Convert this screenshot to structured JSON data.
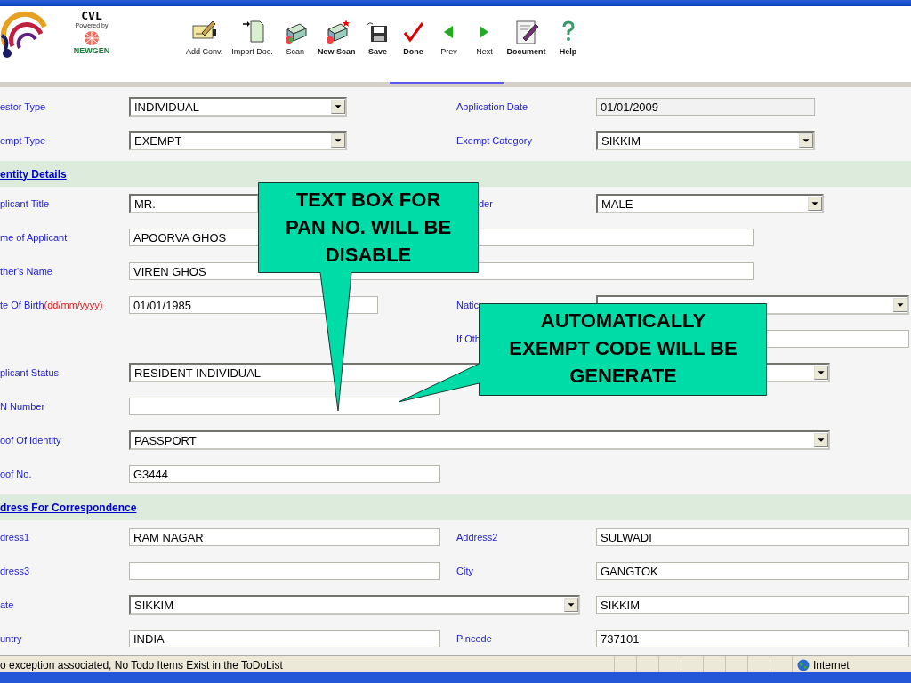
{
  "toolbar": {
    "logo": {
      "title": "CVL",
      "powered_by": "Powered by",
      "vendor": "NEWGEN"
    },
    "buttons": [
      {
        "label": "Add Conv.",
        "bold": false
      },
      {
        "label": "Import Doc.",
        "bold": false
      },
      {
        "label": "Scan",
        "bold": false
      },
      {
        "label": "New Scan",
        "bold": true
      },
      {
        "label": "Save",
        "bold": true
      },
      {
        "label": "Done",
        "bold": true
      },
      {
        "label": "Prev",
        "bold": false
      },
      {
        "label": "Next",
        "bold": false
      },
      {
        "label": "Document",
        "bold": true
      },
      {
        "label": "Help",
        "bold": true
      }
    ]
  },
  "form": {
    "sections": [
      {
        "rows": [
          {
            "label": "estor Type",
            "field": {
              "kind": "select",
              "value": "INDIVIDUAL"
            },
            "label2": "Application Date",
            "field2": {
              "kind": "input",
              "value": "01/01/2009",
              "readonly": true
            }
          },
          {
            "label": "empt Type",
            "field": {
              "kind": "select",
              "value": "EXEMPT"
            },
            "label2": "Exempt Category",
            "field2": {
              "kind": "select",
              "value": "SIKKIM"
            }
          }
        ]
      },
      {
        "title": "entity Details",
        "rows": [
          {
            "label": "plicant Title",
            "field": {
              "kind": "select",
              "value": "MR."
            },
            "label2": "der",
            "field2": {
              "kind": "select",
              "value": "MALE"
            }
          },
          {
            "label": "me of Applicant",
            "field": {
              "kind": "input",
              "value": "APOORVA GHOS"
            }
          },
          {
            "label": "ther's Name",
            "field": {
              "kind": "input",
              "value": "VIREN GHOS"
            }
          },
          {
            "label": "te Of Birth",
            "note": "(dd/mm/yyyy)",
            "field": {
              "kind": "input",
              "value": "01/01/1985"
            },
            "label2": "Natic",
            "field2": {
              "kind": "select"
            }
          },
          {
            "label2": "If Oth",
            "field2": {
              "kind": "input"
            }
          },
          {
            "label": "plicant Status",
            "field": {
              "kind": "select",
              "value": "RESIDENT INDIVIDUAL"
            }
          },
          {
            "label": "N Number",
            "field": {
              "kind": "input"
            }
          },
          {
            "label": "oof Of Identity",
            "field": {
              "kind": "select",
              "value": "PASSPORT"
            }
          },
          {
            "label": "oof No.",
            "field": {
              "kind": "input",
              "value": "G3444"
            }
          }
        ]
      },
      {
        "title": "dress For Correspondence",
        "rows": [
          {
            "label": "dress1",
            "field": {
              "kind": "input",
              "value": "RAM NAGAR"
            },
            "label2": "Address2",
            "field2": {
              "kind": "input",
              "value": "SULWADI"
            }
          },
          {
            "label": "dress3",
            "field": {
              "kind": "input"
            },
            "label2": "City",
            "field2": {
              "kind": "input",
              "value": "GANGTOK"
            }
          },
          {
            "label": "ate",
            "field": {
              "kind": "select",
              "value": "SIKKIM"
            },
            "field2": {
              "kind": "input",
              "value": "SIKKIM"
            }
          },
          {
            "label": "untry",
            "field": {
              "kind": "input",
              "value": "INDIA"
            },
            "label2": "Pincode",
            "field2": {
              "kind": "input",
              "value": "737101"
            }
          }
        ]
      }
    ]
  },
  "status_bar": {
    "message": "o exception associated, No Todo Items Exist in the ToDoList",
    "zone": "Internet"
  },
  "callouts": [
    "TEXT BOX FOR\nPAN NO. WILL BE\nDISABLE",
    "AUTOMATICALLY\nEXEMPT CODE WILL BE\nGENERATE"
  ]
}
